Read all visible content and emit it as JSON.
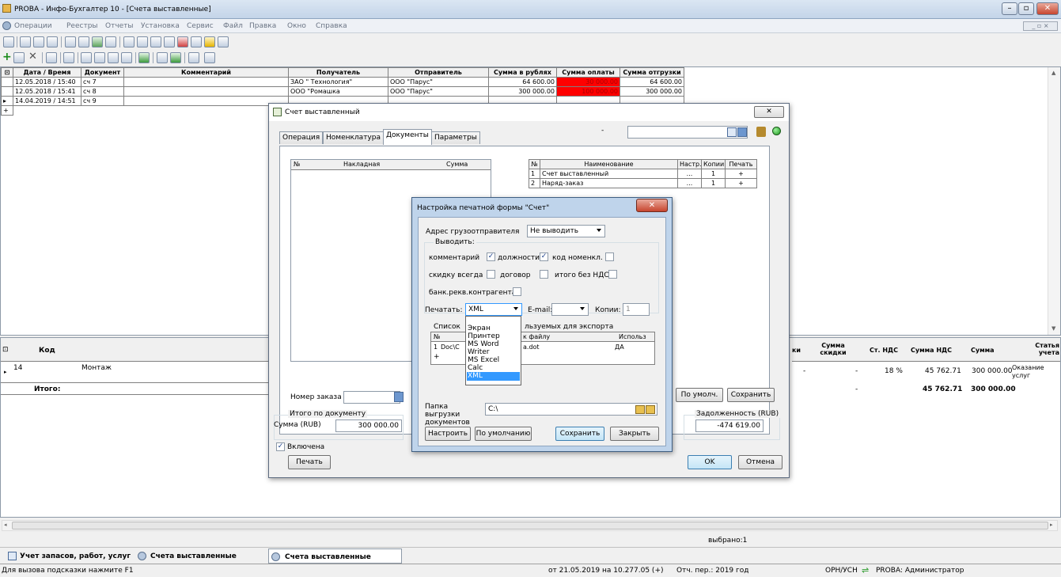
{
  "window": {
    "title": "PROBA - Инфо-Бухгалтер 10 - [Счета выставленные]"
  },
  "menu": [
    "Операции",
    "Реестры",
    "Отчеты",
    "Установка",
    "Сервис",
    "Файл",
    "Правка",
    "Окно",
    "Справка"
  ],
  "main_table": {
    "columns": [
      "Дата / Время",
      "Документ",
      "Комментарий",
      "Получатель",
      "Отправитель",
      "Сумма в рублях",
      "Сумма оплаты",
      "Сумма отгрузки"
    ],
    "rows": [
      {
        "date": "12.05.2018 / 15:40",
        "doc": "сч 7",
        "comment": "",
        "recipient": "ЗАО \" Технология\"",
        "sender": "ООО \"Парус\"",
        "sum": "64 600.00",
        "paid": "30 000.00",
        "shipped": "64 600.00"
      },
      {
        "date": "12.05.2018 / 15:41",
        "doc": "сч 8",
        "comment": "",
        "recipient": "ООО \"Ромашка",
        "sender": "ООО \"Парус\"",
        "sum": "300 000.00",
        "paid": "100 000.00",
        "shipped": "300 000.00"
      },
      {
        "date": "14.04.2019 / 14:51",
        "doc": "сч 9",
        "comment": "",
        "recipient": "",
        "sender": "",
        "sum": "",
        "paid": "",
        "shipped": ""
      }
    ]
  },
  "lower_table": {
    "columns": {
      "code": "Код",
      "ki": "ки",
      "discount": "Сумма скидки",
      "vat_rate": "Ст. НДС",
      "vat_sum": "Сумма НДС",
      "sum": "Сумма",
      "article": "Статья учета"
    },
    "row": {
      "code": "14",
      "name": "Монтаж",
      "discount": "-",
      "vat_rate": "18 %",
      "vat_sum": "45 762.71",
      "sum": "300 000.00",
      "article": "Оказание услуг",
      "dash": "-"
    },
    "total": {
      "label": "Итого:",
      "dash": "-",
      "vat_sum": "45 762.71",
      "sum": "300 000.00"
    }
  },
  "selected_count": "выбрано:1",
  "invoice_dialog": {
    "title": "Счет выставленный",
    "tabs": [
      "Операция",
      "Номенклатура",
      "Документы",
      "Параметры"
    ],
    "dash": "-",
    "left_table": {
      "columns": [
        "№",
        "Накладная",
        "Сумма"
      ]
    },
    "right_table": {
      "columns": [
        "№",
        "Наименование",
        "Настр.",
        "Копии",
        "Печать"
      ],
      "rows": [
        {
          "n": "1",
          "name": "Счет выставленный",
          "set": "...",
          "copies": "1",
          "print": "+"
        },
        {
          "n": "2",
          "name": "Наряд-заказ",
          "set": "...",
          "copies": "1",
          "print": "+"
        }
      ]
    },
    "order_no_label": "Номер заказа",
    "totals_group": "Итого по документу",
    "sum_label": "Сумма (RUB)",
    "sum_value": "300 000.00",
    "enabled_label": "Включена",
    "debt_group": "Задолженность (RUB)",
    "debt_value": "-474 619.00",
    "buttons": {
      "default": "По умолч.",
      "save": "Сохранить",
      "print": "Печать",
      "ok": "OK",
      "cancel": "Отмена"
    }
  },
  "print_dialog": {
    "title": "Настройка печатной формы \"Счет\"",
    "consignor_label": "Адрес грузоотправителя",
    "consignor_value": "Не выводить",
    "output_group": "Выводить:",
    "checks": [
      {
        "label": "комментарий",
        "checked": true
      },
      {
        "label": "должности",
        "checked": true
      },
      {
        "label": "код номенкл.",
        "checked": false
      },
      {
        "label": "скидку всегда",
        "checked": false
      },
      {
        "label": "договор",
        "checked": false
      },
      {
        "label": "итого без НДС",
        "checked": false
      },
      {
        "label": "банк.рекв.контрагента",
        "checked": false
      }
    ],
    "print_label": "Печатать:",
    "print_value": "XML",
    "email_label": "E-mail:",
    "email_value": "",
    "copies_label": "Копии:",
    "copies_value": "1",
    "export_label_left": "Список",
    "export_label_right": "льзуемых для экспорта",
    "export_columns": [
      "№",
      "к файлу",
      "Использ"
    ],
    "export_row": {
      "n": "1",
      "path_start": "Doc\\C",
      "path_end": "a.dot",
      "use": "ДА"
    },
    "dropdown_options": [
      "Экран",
      "Принтер",
      "MS Word",
      "Writer",
      "MS Excel",
      "Calc",
      "XML"
    ],
    "dropdown_selected": "XML",
    "folder_label": "Папка выгрузки документов",
    "folder_value": "C:\\",
    "buttons": {
      "setup": "Настроить",
      "default": "По умолчанию",
      "save": "Сохранить",
      "close": "Закрыть"
    }
  },
  "taskbar": [
    "Учет запасов, работ, услуг",
    "Счета выставленные",
    "Счета выставленные"
  ],
  "status": {
    "hint": "Для вызова подсказки нажмите F1",
    "version": "от 21.05.2019 на 10.277.05 (+)",
    "period": "Отч. пер.: 2019 год",
    "org": "ОРН/УСН",
    "user": "PROBA: Администратор"
  },
  "colors": {
    "titlebar": "#c4d4e8",
    "highlight": "#3399ff",
    "paid_red": "#ff0000",
    "grid_line": "#808080"
  }
}
